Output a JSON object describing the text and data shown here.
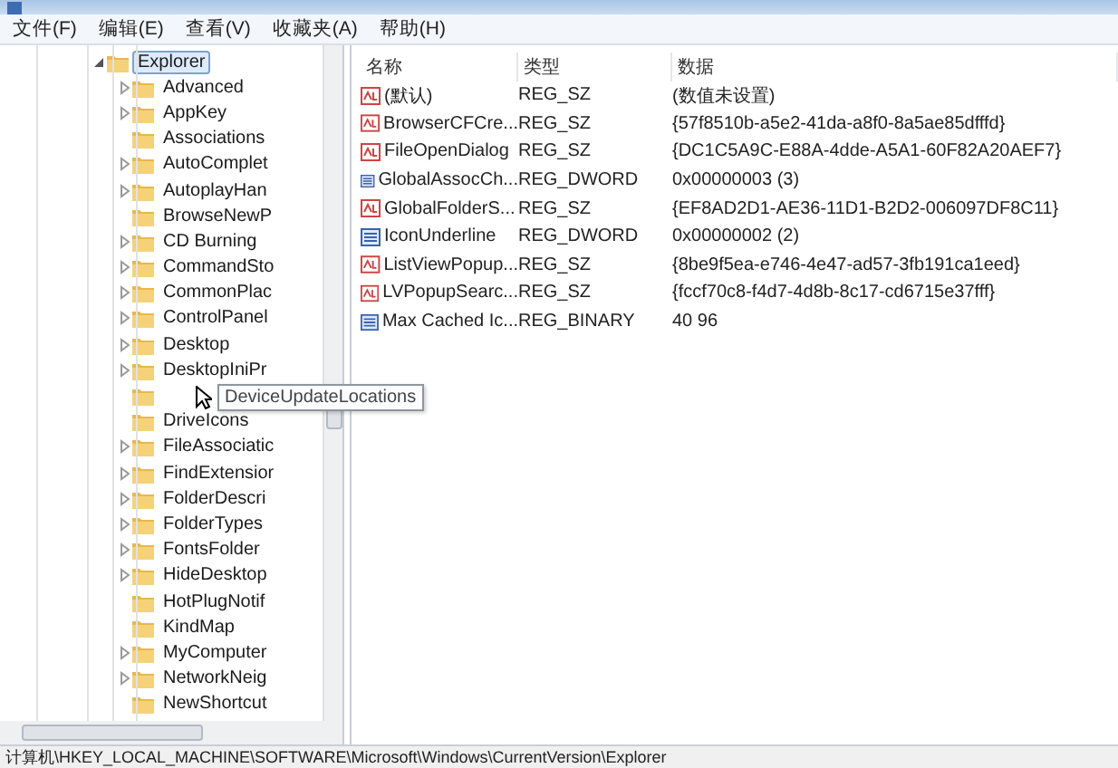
{
  "menu": [
    {
      "label": "文件(F)"
    },
    {
      "label": "编辑(E)"
    },
    {
      "label": "查看(V)"
    },
    {
      "label": "收藏夹(A)"
    },
    {
      "label": "帮助(H)"
    }
  ],
  "tree": {
    "root": {
      "label": "Explorer",
      "expanded": true,
      "selected": true,
      "children": [
        {
          "label": "Advanced",
          "expandable": true
        },
        {
          "label": "AppKey",
          "expandable": true
        },
        {
          "label": "Associations",
          "expandable": false
        },
        {
          "label": "AutoComplet",
          "expandable": true
        },
        {
          "label": "AutoplayHan",
          "expandable": true
        },
        {
          "label": "BrowseNewP",
          "expandable": false
        },
        {
          "label": "CD Burning",
          "expandable": true
        },
        {
          "label": "CommandSto",
          "expandable": true
        },
        {
          "label": "CommonPlac",
          "expandable": true
        },
        {
          "label": "ControlPanel",
          "expandable": true
        },
        {
          "label": "Desktop",
          "expandable": true
        },
        {
          "label": "DesktopIniPr",
          "expandable": true
        },
        {
          "expandable": false
        },
        {
          "label": "DriveIcons",
          "expandable": false
        },
        {
          "label": "FileAssociatic",
          "expandable": true
        },
        {
          "label": "FindExtensior",
          "expandable": true
        },
        {
          "label": "FolderDescri",
          "expandable": true
        },
        {
          "label": "FolderTypes",
          "expandable": true
        },
        {
          "label": "FontsFolder",
          "expandable": true
        },
        {
          "label": "HideDesktop",
          "expandable": true
        },
        {
          "label": "HotPlugNotif",
          "expandable": false
        },
        {
          "label": "KindMap",
          "expandable": false
        },
        {
          "label": "MyComputer",
          "expandable": true
        },
        {
          "label": "NetworkNeig",
          "expandable": true
        },
        {
          "label": "NewShortcut",
          "expandable": false
        }
      ]
    }
  },
  "tooltip": {
    "text": "DeviceUpdateLocations"
  },
  "table": {
    "columns": [
      "名称",
      "类型",
      "数据"
    ],
    "rows": [
      {
        "kind": "string",
        "name": "(默认)",
        "type": "REG_SZ",
        "data": "(数值未设置)"
      },
      {
        "kind": "string",
        "name": "BrowserCFCre...",
        "type": "REG_SZ",
        "data": "{57f8510b-a5e2-41da-a8f0-8a5ae85dfffd}"
      },
      {
        "kind": "string",
        "name": "FileOpenDialog",
        "type": "REG_SZ",
        "data": "{DC1C5A9C-E88A-4dde-A5A1-60F82A20AEF7}"
      },
      {
        "kind": "binary",
        "name": "GlobalAssocCh...",
        "type": "REG_DWORD",
        "data": "0x00000003 (3)"
      },
      {
        "kind": "string",
        "name": "GlobalFolderS...",
        "type": "REG_SZ",
        "data": "{EF8AD2D1-AE36-11D1-B2D2-006097DF8C11}"
      },
      {
        "kind": "binary",
        "name": "IconUnderline",
        "type": "REG_DWORD",
        "data": "0x00000002 (2)"
      },
      {
        "kind": "string",
        "name": "ListViewPopup...",
        "type": "REG_SZ",
        "data": "{8be9f5ea-e746-4e47-ad57-3fb191ca1eed}"
      },
      {
        "kind": "string",
        "name": "LVPopupSearc...",
        "type": "REG_SZ",
        "data": "{fccf70c8-f4d7-4d8b-8c17-cd6715e37fff}"
      },
      {
        "kind": "binary",
        "name": "Max Cached Ic...",
        "type": "REG_BINARY",
        "data": "40 96"
      }
    ]
  },
  "status_bar": {
    "path": "计算机\\HKEY_LOCAL_MACHINE\\SOFTWARE\\Microsoft\\Windows\\CurrentVersion\\Explorer"
  }
}
